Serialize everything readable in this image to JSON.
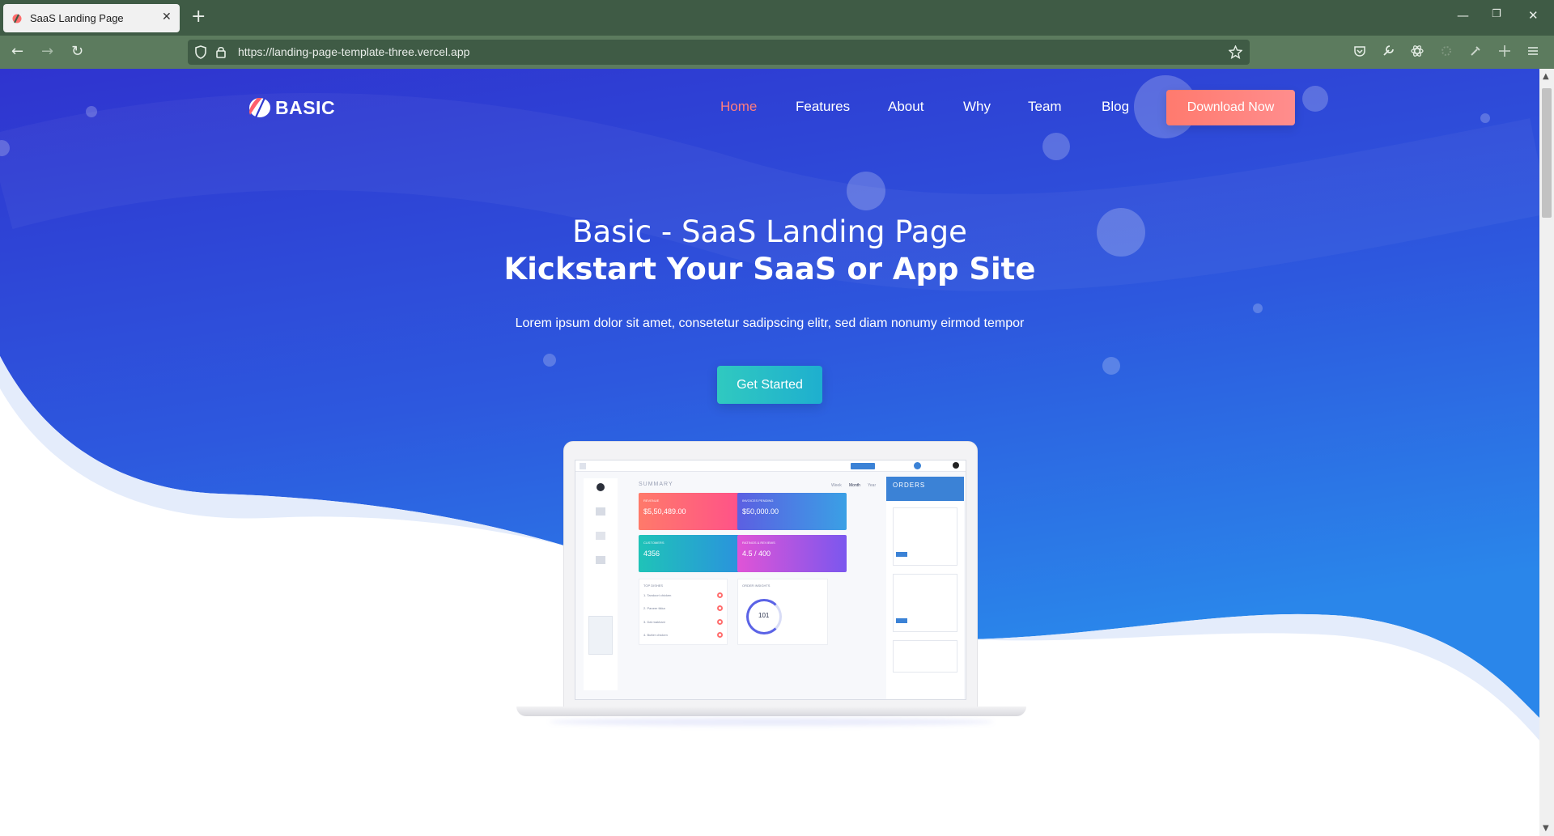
{
  "browser": {
    "tab_title": "SaaS Landing Page",
    "tab_close": "✕",
    "new_tab": "+",
    "url": "https://landing-page-template-three.vercel.app",
    "window_controls": [
      "—",
      "❐",
      "✕"
    ]
  },
  "site": {
    "logo_text": "BASIC",
    "menu": [
      "Home",
      "Features",
      "About",
      "Why",
      "Team",
      "Blog"
    ],
    "active_menu": "Home",
    "download_label": "Download Now"
  },
  "hero": {
    "title_line1": "Basic - SaaS Landing Page",
    "title_line2": "Kickstart Your SaaS or App Site",
    "subtitle": "Lorem ipsum dolor sit amet, consetetur sadipscing elitr, sed diam nonumy eirmod tempor",
    "cta_label": "Get Started"
  },
  "dashboard": {
    "summary_label": "SUMMARY",
    "tabs": [
      "Week",
      "Month",
      "Year"
    ],
    "cards": [
      {
        "label": "REVENUE",
        "value": "$5,50,489.00"
      },
      {
        "label": "INVOICES PENDING",
        "value": "$50,000.00"
      },
      {
        "label": "CUSTOMERS",
        "value": "4356"
      },
      {
        "label": "RATINGS & REVIEWS",
        "value": "4.5 / 400"
      }
    ],
    "top_dishes_label": "TOP DISHES",
    "dishes": [
      "1. Tandoori chicken",
      "2. Paneer tikka",
      "3. Dal makhani",
      "4. Butter chicken"
    ],
    "order_insights_label": "ORDER INSIGHTS",
    "gauge_value": "101",
    "orders_label": "ORDERS"
  },
  "colors": {
    "hero_top": "#2f35cf",
    "hero_bottom": "#2b7fe6",
    "accent_coral": "#ff7b72",
    "accent_teal": "#26bfc6",
    "active_link": "#ff7d7d"
  }
}
